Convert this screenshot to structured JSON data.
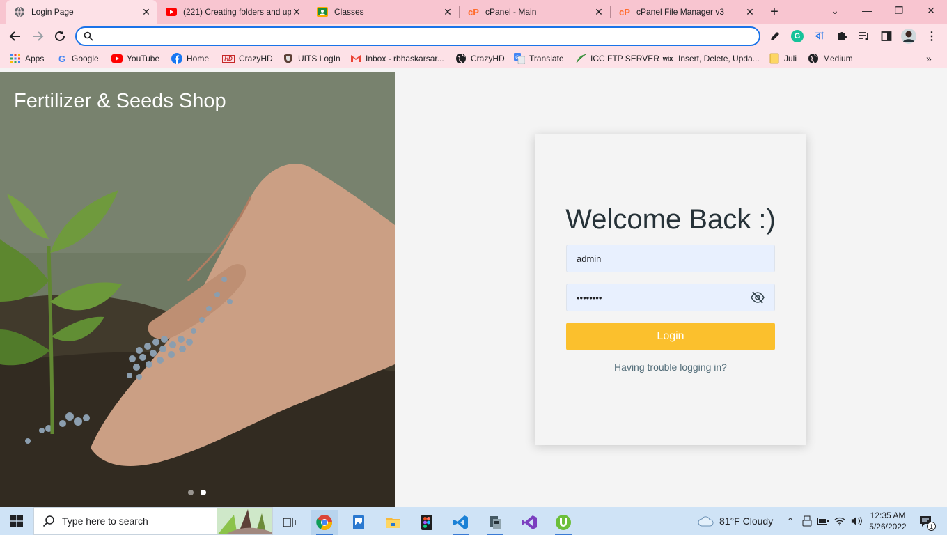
{
  "browser": {
    "tabs": [
      {
        "title": "Login Page",
        "icon": "globe-icon",
        "active": true
      },
      {
        "title": "(221) Creating folders and up",
        "icon": "youtube-icon",
        "active": false
      },
      {
        "title": "Classes",
        "icon": "classroom-icon",
        "active": false
      },
      {
        "title": "cPanel - Main",
        "icon": "cpanel-icon",
        "active": false
      },
      {
        "title": "cPanel File Manager v3",
        "icon": "cpanel-icon",
        "active": false
      }
    ],
    "omnibox": {
      "value": "",
      "placeholder": ""
    },
    "bookmarks": [
      {
        "label": "Apps",
        "icon": "apps-grid-icon"
      },
      {
        "label": "Google",
        "icon": "google-icon"
      },
      {
        "label": "YouTube",
        "icon": "youtube-icon"
      },
      {
        "label": "Home",
        "icon": "facebook-icon"
      },
      {
        "label": "CrazyHD",
        "icon": "hd-icon"
      },
      {
        "label": "UITS LogIn",
        "icon": "shield-icon"
      },
      {
        "label": "Inbox - rbhaskarsar...",
        "icon": "gmail-icon"
      },
      {
        "label": "CrazyHD",
        "icon": "globe-icon"
      },
      {
        "label": "Translate",
        "icon": "translate-icon"
      },
      {
        "label": "ICC FTP SERVER",
        "icon": "leaf-icon"
      },
      {
        "label": "Insert, Delete, Upda...",
        "icon": "wix-icon"
      },
      {
        "label": "Juli",
        "icon": "folder-icon"
      },
      {
        "label": "Medium",
        "icon": "globe-icon"
      }
    ],
    "ext_grammarly_letter": "G",
    "ext_bangla_letter": "বা"
  },
  "page": {
    "hero_title": "Fertilizer & Seeds Shop",
    "login": {
      "heading": "Welcome Back :)",
      "username_value": "admin",
      "password_value": "••••••••",
      "button_label": "Login",
      "trouble_link": "Having trouble logging in?"
    }
  },
  "taskbar": {
    "search_placeholder": "Type here to search",
    "weather": "81°F  Cloudy",
    "time": "12:35 AM",
    "date": "5/26/2022",
    "notification_count": "1"
  },
  "colors": {
    "accent_button": "#fbc02d",
    "field_bg": "#e8f0fe",
    "tab_strip": "#f8c5d0",
    "toolbar": "#fde1e7"
  }
}
